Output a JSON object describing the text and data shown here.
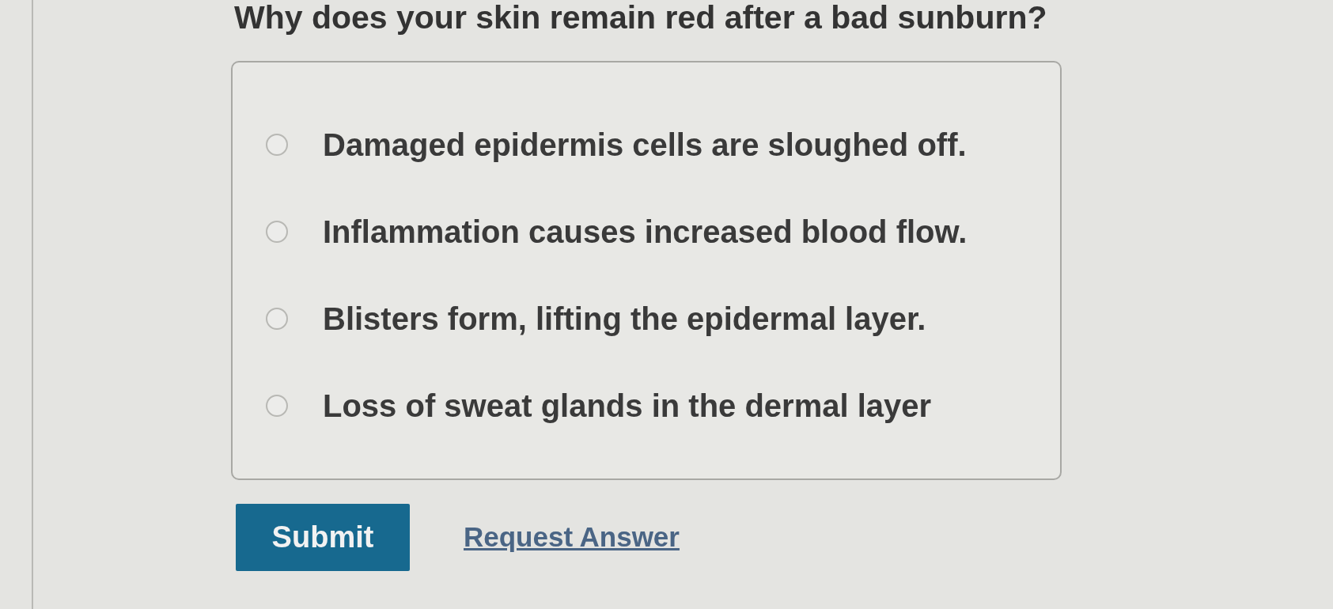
{
  "question": "Why does your skin remain red after a bad sunburn?",
  "options": [
    {
      "label": "Damaged epidermis cells are sloughed off.",
      "selected": false
    },
    {
      "label": "Inflammation causes increased blood flow.",
      "selected": false
    },
    {
      "label": "Blisters form, lifting the epidermal layer.",
      "selected": false
    },
    {
      "label": "Loss of sweat glands in the dermal layer",
      "selected": false
    }
  ],
  "actions": {
    "submit": "Submit",
    "request_answer": "Request Answer"
  }
}
